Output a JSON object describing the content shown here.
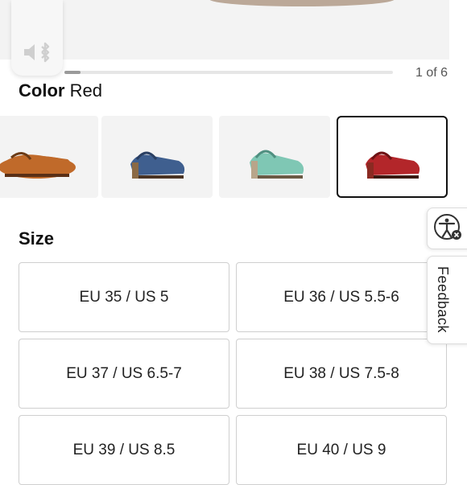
{
  "gallery": {
    "counter": "1 of 6",
    "progress": 0.05,
    "audio_icon": "speaker-bluetooth-icon"
  },
  "color": {
    "label": "Color",
    "selected": "Red",
    "swatches": [
      {
        "name": "Camel",
        "shoe_color": "#c06a2a",
        "selected": false
      },
      {
        "name": "Blue",
        "shoe_color": "#3f5f8f",
        "selected": false
      },
      {
        "name": "Turquoise",
        "shoe_color": "#7fc7b4",
        "selected": false
      },
      {
        "name": "Red",
        "shoe_color": "#b3262a",
        "selected": true
      }
    ]
  },
  "size": {
    "label": "Size",
    "options": [
      "EU 35 / US 5",
      "EU 36 / US 5.5-6",
      "EU 37 / US 6.5-7",
      "EU 38 / US 7.5-8",
      "EU 39 / US 8.5",
      "EU 40 / US 9"
    ]
  },
  "side_tabs": {
    "accessibility_icon": "accessibility-icon",
    "feedback_label": "Feedback"
  }
}
